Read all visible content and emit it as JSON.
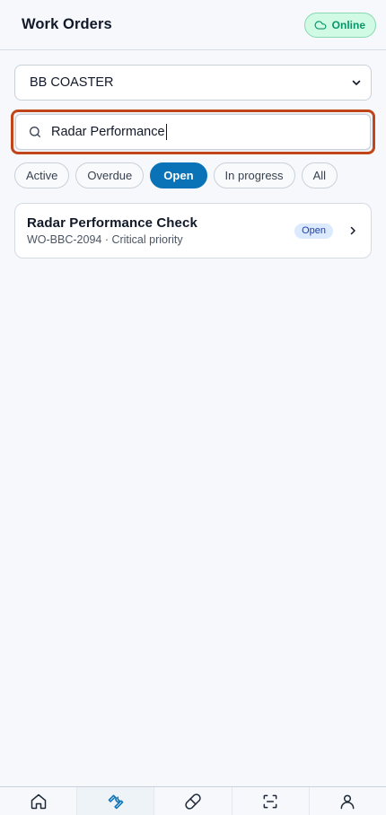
{
  "header": {
    "title": "Work Orders",
    "status_label": "Online",
    "status_icon": "cloud-icon"
  },
  "vessel_select": {
    "selected": "BB COASTER"
  },
  "search": {
    "value": "Radar Performance",
    "icon": "search-icon"
  },
  "filters": [
    {
      "label": "Active",
      "active": false
    },
    {
      "label": "Overdue",
      "active": false
    },
    {
      "label": "Open",
      "active": true
    },
    {
      "label": "In progress",
      "active": false
    },
    {
      "label": "All",
      "active": false
    }
  ],
  "work_orders": [
    {
      "title": "Radar Performance Check",
      "subtitle": "WO-BBC-2094 · Critical priority",
      "status": "Open"
    }
  ],
  "bottom_nav": [
    {
      "icon": "home-icon",
      "active": false
    },
    {
      "icon": "wrench-icon",
      "active": true
    },
    {
      "icon": "pill-icon",
      "active": false
    },
    {
      "icon": "scan-icon",
      "active": false
    },
    {
      "icon": "user-icon",
      "active": false
    }
  ],
  "colors": {
    "accent": "#0a73b7",
    "focus_outline": "#c0461a",
    "online_bg": "#d1fae5",
    "online_text": "#059669"
  }
}
